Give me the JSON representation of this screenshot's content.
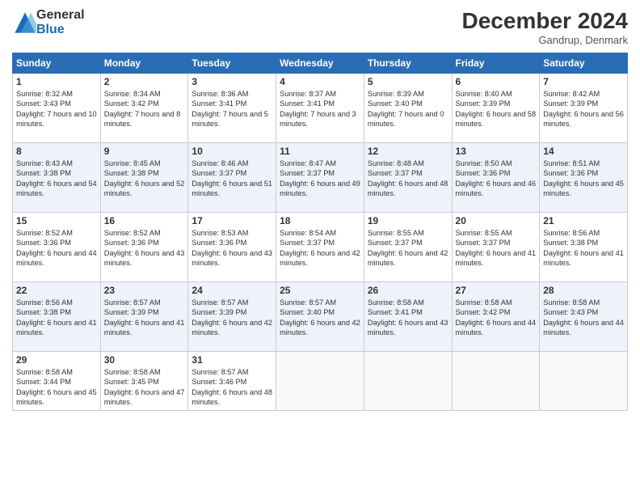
{
  "logo": {
    "general": "General",
    "blue": "Blue"
  },
  "header": {
    "month": "December 2024",
    "location": "Gandrup, Denmark"
  },
  "days_of_week": [
    "Sunday",
    "Monday",
    "Tuesday",
    "Wednesday",
    "Thursday",
    "Friday",
    "Saturday"
  ],
  "weeks": [
    [
      {
        "day": 1,
        "sunrise": "8:32 AM",
        "sunset": "3:43 PM",
        "daylight": "7 hours and 10 minutes."
      },
      {
        "day": 2,
        "sunrise": "8:34 AM",
        "sunset": "3:42 PM",
        "daylight": "7 hours and 8 minutes."
      },
      {
        "day": 3,
        "sunrise": "8:36 AM",
        "sunset": "3:41 PM",
        "daylight": "7 hours and 5 minutes."
      },
      {
        "day": 4,
        "sunrise": "8:37 AM",
        "sunset": "3:41 PM",
        "daylight": "7 hours and 3 minutes."
      },
      {
        "day": 5,
        "sunrise": "8:39 AM",
        "sunset": "3:40 PM",
        "daylight": "7 hours and 0 minutes."
      },
      {
        "day": 6,
        "sunrise": "8:40 AM",
        "sunset": "3:39 PM",
        "daylight": "6 hours and 58 minutes."
      },
      {
        "day": 7,
        "sunrise": "8:42 AM",
        "sunset": "3:39 PM",
        "daylight": "6 hours and 56 minutes."
      }
    ],
    [
      {
        "day": 8,
        "sunrise": "8:43 AM",
        "sunset": "3:38 PM",
        "daylight": "6 hours and 54 minutes."
      },
      {
        "day": 9,
        "sunrise": "8:45 AM",
        "sunset": "3:38 PM",
        "daylight": "6 hours and 52 minutes."
      },
      {
        "day": 10,
        "sunrise": "8:46 AM",
        "sunset": "3:37 PM",
        "daylight": "6 hours and 51 minutes."
      },
      {
        "day": 11,
        "sunrise": "8:47 AM",
        "sunset": "3:37 PM",
        "daylight": "6 hours and 49 minutes."
      },
      {
        "day": 12,
        "sunrise": "8:48 AM",
        "sunset": "3:37 PM",
        "daylight": "6 hours and 48 minutes."
      },
      {
        "day": 13,
        "sunrise": "8:50 AM",
        "sunset": "3:36 PM",
        "daylight": "6 hours and 46 minutes."
      },
      {
        "day": 14,
        "sunrise": "8:51 AM",
        "sunset": "3:36 PM",
        "daylight": "6 hours and 45 minutes."
      }
    ],
    [
      {
        "day": 15,
        "sunrise": "8:52 AM",
        "sunset": "3:36 PM",
        "daylight": "6 hours and 44 minutes."
      },
      {
        "day": 16,
        "sunrise": "8:52 AM",
        "sunset": "3:36 PM",
        "daylight": "6 hours and 43 minutes."
      },
      {
        "day": 17,
        "sunrise": "8:53 AM",
        "sunset": "3:36 PM",
        "daylight": "6 hours and 43 minutes."
      },
      {
        "day": 18,
        "sunrise": "8:54 AM",
        "sunset": "3:37 PM",
        "daylight": "6 hours and 42 minutes."
      },
      {
        "day": 19,
        "sunrise": "8:55 AM",
        "sunset": "3:37 PM",
        "daylight": "6 hours and 42 minutes."
      },
      {
        "day": 20,
        "sunrise": "8:55 AM",
        "sunset": "3:37 PM",
        "daylight": "6 hours and 41 minutes."
      },
      {
        "day": 21,
        "sunrise": "8:56 AM",
        "sunset": "3:38 PM",
        "daylight": "6 hours and 41 minutes."
      }
    ],
    [
      {
        "day": 22,
        "sunrise": "8:56 AM",
        "sunset": "3:38 PM",
        "daylight": "6 hours and 41 minutes."
      },
      {
        "day": 23,
        "sunrise": "8:57 AM",
        "sunset": "3:39 PM",
        "daylight": "6 hours and 41 minutes."
      },
      {
        "day": 24,
        "sunrise": "8:57 AM",
        "sunset": "3:39 PM",
        "daylight": "6 hours and 42 minutes."
      },
      {
        "day": 25,
        "sunrise": "8:57 AM",
        "sunset": "3:40 PM",
        "daylight": "6 hours and 42 minutes."
      },
      {
        "day": 26,
        "sunrise": "8:58 AM",
        "sunset": "3:41 PM",
        "daylight": "6 hours and 43 minutes."
      },
      {
        "day": 27,
        "sunrise": "8:58 AM",
        "sunset": "3:42 PM",
        "daylight": "6 hours and 44 minutes."
      },
      {
        "day": 28,
        "sunrise": "8:58 AM",
        "sunset": "3:43 PM",
        "daylight": "6 hours and 44 minutes."
      }
    ],
    [
      {
        "day": 29,
        "sunrise": "8:58 AM",
        "sunset": "3:44 PM",
        "daylight": "6 hours and 45 minutes."
      },
      {
        "day": 30,
        "sunrise": "8:58 AM",
        "sunset": "3:45 PM",
        "daylight": "6 hours and 47 minutes."
      },
      {
        "day": 31,
        "sunrise": "8:57 AM",
        "sunset": "3:46 PM",
        "daylight": "6 hours and 48 minutes."
      },
      null,
      null,
      null,
      null
    ]
  ],
  "labels": {
    "sunrise": "Sunrise:",
    "sunset": "Sunset:",
    "daylight": "Daylight:"
  }
}
